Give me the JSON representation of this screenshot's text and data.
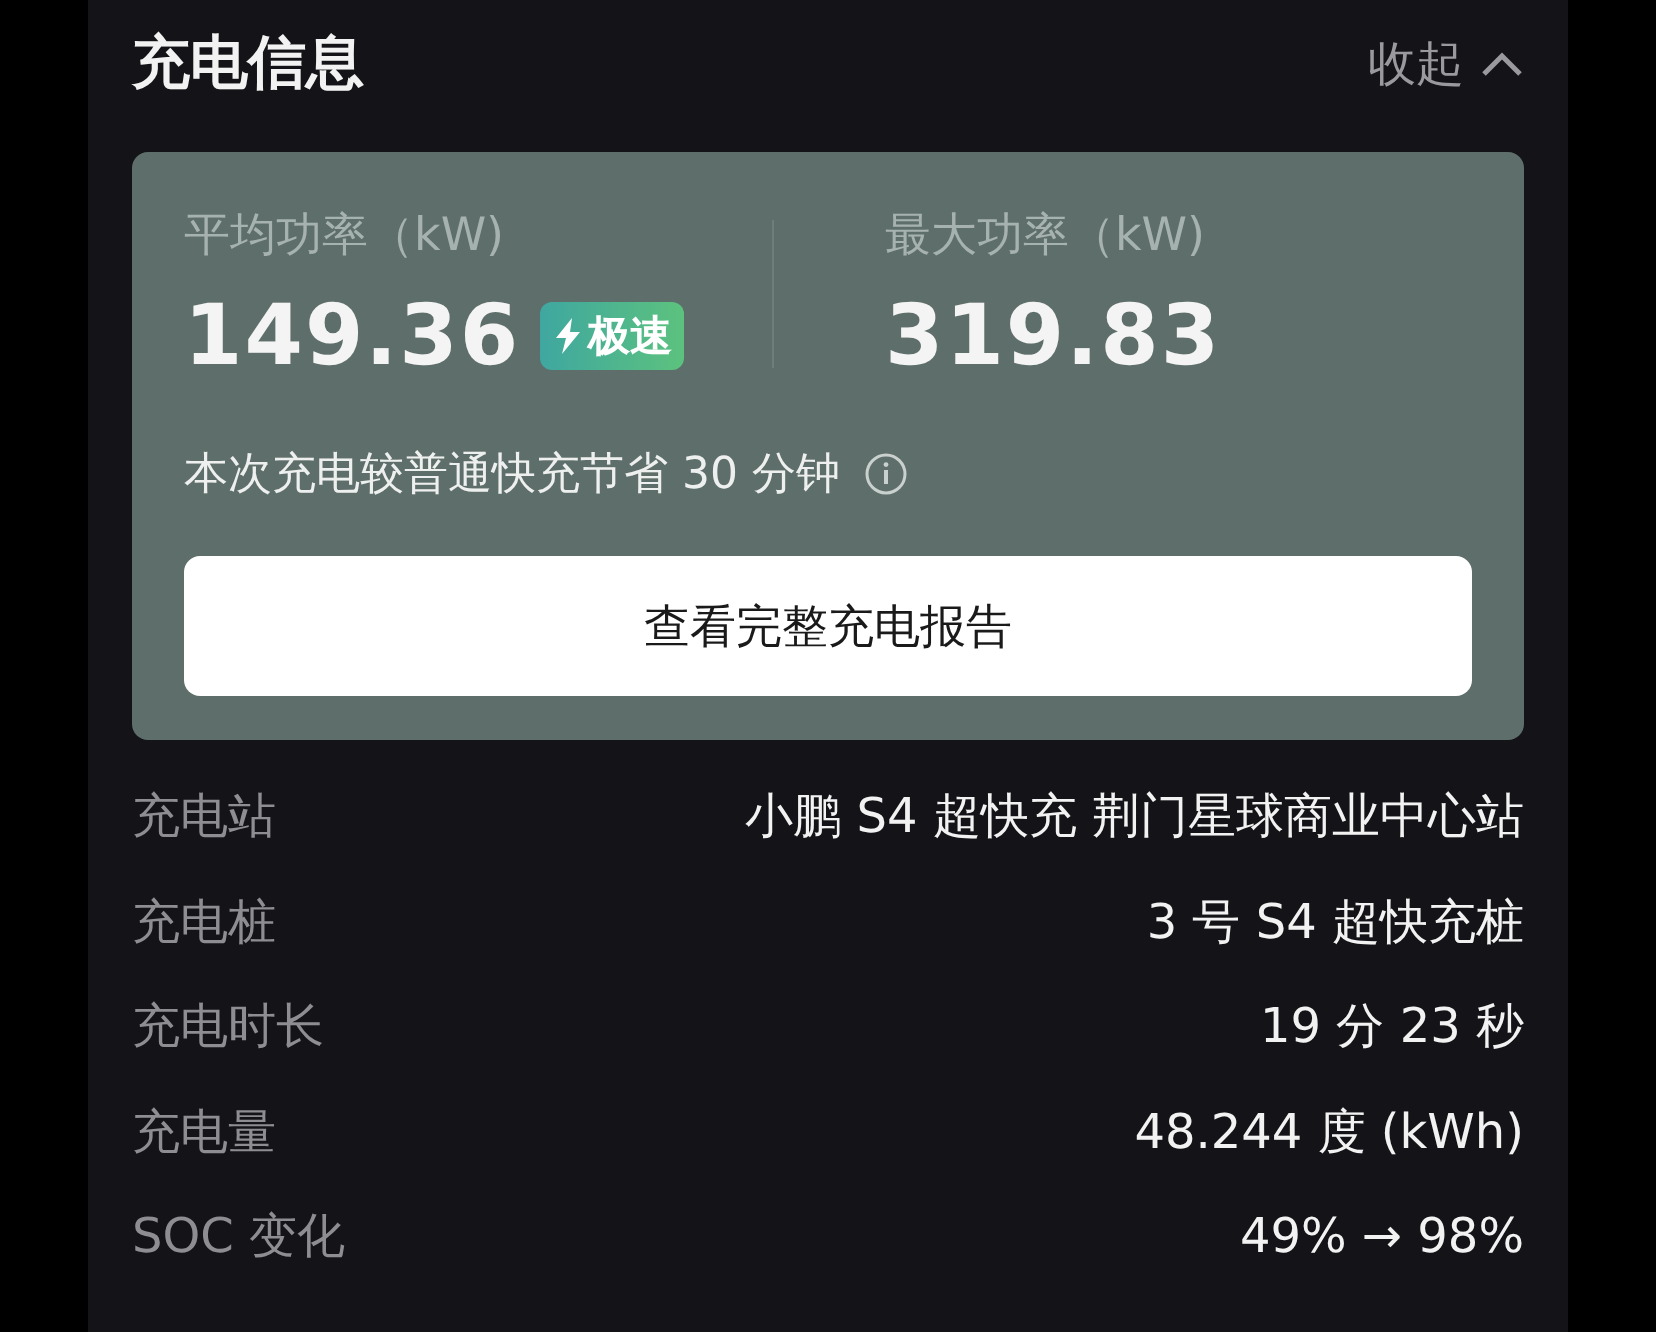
{
  "section": {
    "title": "充电信息",
    "toggle_label": "收起",
    "expanded": true
  },
  "summary": {
    "stats": [
      {
        "label": "平均功率（kW)",
        "value": "149.36",
        "badge": "极速"
      },
      {
        "label": "最大功率（kW)",
        "value": "319.83"
      }
    ],
    "savings_note": "本次充电较普通快充节省 30 分钟",
    "report_button": "查看完整充电报告"
  },
  "details": [
    {
      "label": "充电站",
      "value": "小鹏 S4 超快充 荆门星球商业中心站"
    },
    {
      "label": "充电桩",
      "value": "3 号 S4 超快充桩"
    },
    {
      "label": "充电时长",
      "value": "19 分 23 秒"
    },
    {
      "label": "充电量",
      "value": "48.244 度 (kWh)"
    },
    {
      "label": "SOC 变化",
      "value": "49% → 98%"
    }
  ]
}
